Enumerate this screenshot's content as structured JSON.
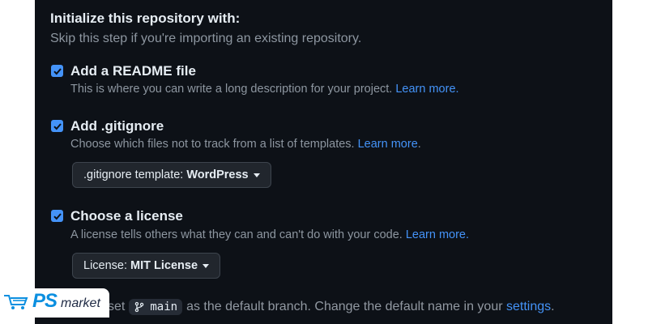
{
  "section": {
    "title": "Initialize this repository with:",
    "subtitle": "Skip this step if you're importing an existing repository."
  },
  "options": [
    {
      "title": "Add a README file",
      "checked": true,
      "description": "This is where you can write a long description for your project.",
      "link": "Learn more."
    },
    {
      "title": "Add .gitignore",
      "checked": true,
      "description": "Choose which files not to track from a list of templates.",
      "link": "Learn more",
      "after_link": ".",
      "select": {
        "label": ".gitignore template:",
        "value": "WordPress"
      }
    },
    {
      "title": "Choose a license",
      "checked": true,
      "description": "A license tells others what they can and can't do with your code.",
      "link": "Learn more.",
      "select": {
        "label": "License:",
        "value": "MIT License"
      }
    }
  ],
  "branch": {
    "prefix": "set",
    "name": "main",
    "suffix": "as the default branch. Change the default name in your",
    "link": "settings",
    "end": "."
  },
  "watermark": {
    "brand": "PS",
    "text": "market"
  },
  "colors": {
    "background": "#0d1117",
    "accent": "#4493f8",
    "muted": "#8d96a0",
    "text": "#e6edf3"
  }
}
